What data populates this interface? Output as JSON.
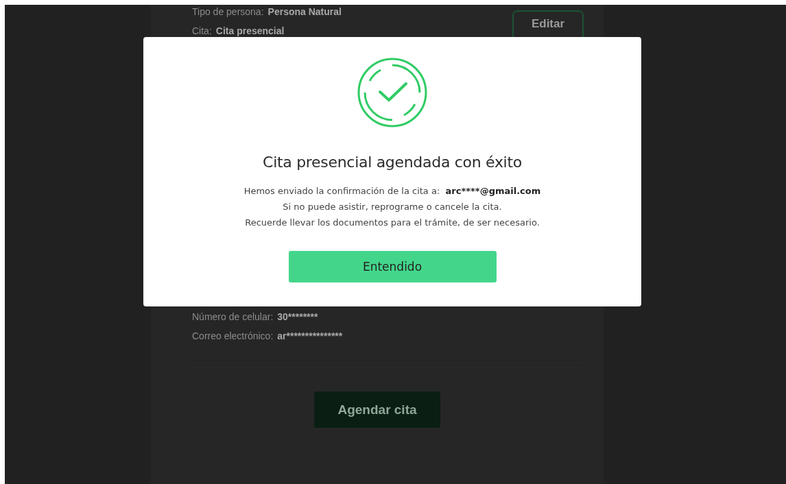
{
  "page": {
    "details_top": [
      {
        "label": "Tipo de persona:",
        "value": "Persona Natural"
      },
      {
        "label": "Cita:",
        "value": "Cita presencial"
      }
    ],
    "edit_button": "Editar",
    "details_bottom": [
      {
        "label": "Número de celular:",
        "value": "30********"
      },
      {
        "label": "Correo electrónico:",
        "value": "ar***************"
      }
    ],
    "schedule_button": "Agendar cita"
  },
  "modal": {
    "title": "Cita presencial agendada con éxito",
    "message": {
      "text": "Hemos enviado la confirmación de la cita a:",
      "email": "arc****@gmail.com"
    },
    "lines": [
      "Si no puede asistir, reprograme o cancele la cita.",
      "Recuerde llevar los documentos para el trámite, de ser necesario."
    ],
    "button": "Entendido"
  }
}
